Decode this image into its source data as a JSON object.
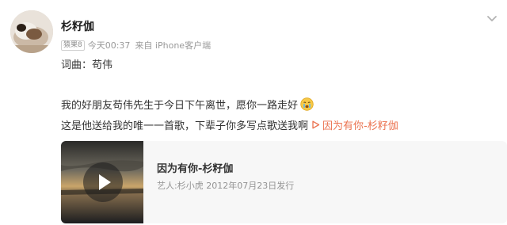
{
  "post": {
    "author": "杉籽伽",
    "badge": "猿果8",
    "timestamp": "今天00:37",
    "source": "来自 iPhone客户端",
    "menu_icon": "chevron-down-icon",
    "lines": [
      "词曲：苟伟",
      "我的好朋友苟伟先生于今日下午离世，愿你一路走好",
      "这是他送给我的唯一一首歌，下辈子你多写点歌送我啊"
    ],
    "emoji": "crying-face-icon",
    "music_link": "因为有你-杉籽伽",
    "music_link_icon": "play-triangle-icon",
    "accent_color": "#eb7350"
  },
  "card": {
    "title": "因为有你-杉籽伽",
    "subtitle": "艺人:杉小虎 2012年07月23日发行",
    "play_icon": "play-icon"
  }
}
